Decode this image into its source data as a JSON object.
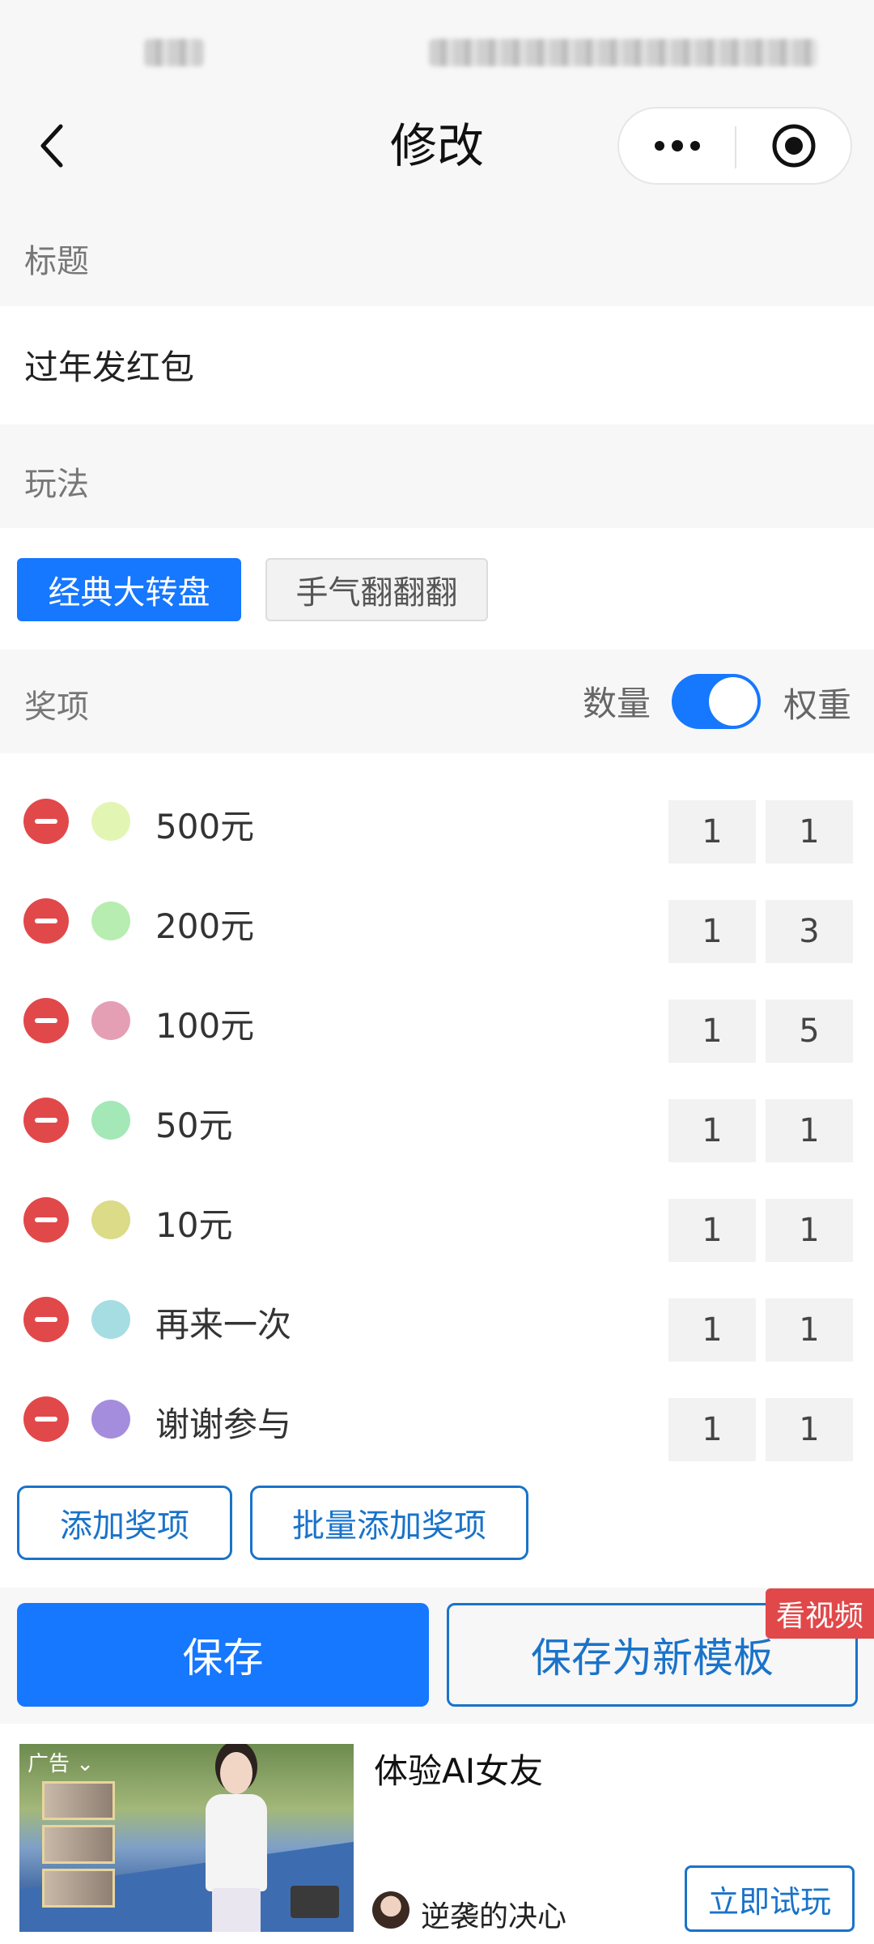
{
  "nav": {
    "title": "修改"
  },
  "sections": {
    "title_label": "标题",
    "mode_label": "玩法",
    "prizes_label": "奖项"
  },
  "title_field": {
    "value": "过年发红包"
  },
  "modes": [
    {
      "label": "经典大转盘",
      "active": true
    },
    {
      "label": "手气翻翻翻",
      "active": false
    }
  ],
  "prize_header": {
    "count_label": "数量",
    "weight_label": "权重",
    "weight_toggle_on": true
  },
  "prizes": [
    {
      "name": "500元",
      "color": "#e3f5b3",
      "count": "1",
      "weight": "1"
    },
    {
      "name": "200元",
      "color": "#b7edb0",
      "count": "1",
      "weight": "3"
    },
    {
      "name": "100元",
      "color": "#e59fb5",
      "count": "1",
      "weight": "5"
    },
    {
      "name": "50元",
      "color": "#a4e8b8",
      "count": "1",
      "weight": "1"
    },
    {
      "name": "10元",
      "color": "#dbdb88",
      "count": "1",
      "weight": "1"
    },
    {
      "name": "再来一次",
      "color": "#a6dde3",
      "count": "1",
      "weight": "1"
    },
    {
      "name": "谢谢参与",
      "color": "#a58ddd",
      "count": "1",
      "weight": "1"
    }
  ],
  "actions": {
    "add_prize": "添加奖项",
    "batch_add": "批量添加奖项",
    "save": "保存",
    "save_new": "保存为新模板",
    "video_badge": "看视频"
  },
  "ad": {
    "label": "广告",
    "title": "体验AI女友",
    "author": "逆袭的决心",
    "cta": "立即试玩"
  }
}
